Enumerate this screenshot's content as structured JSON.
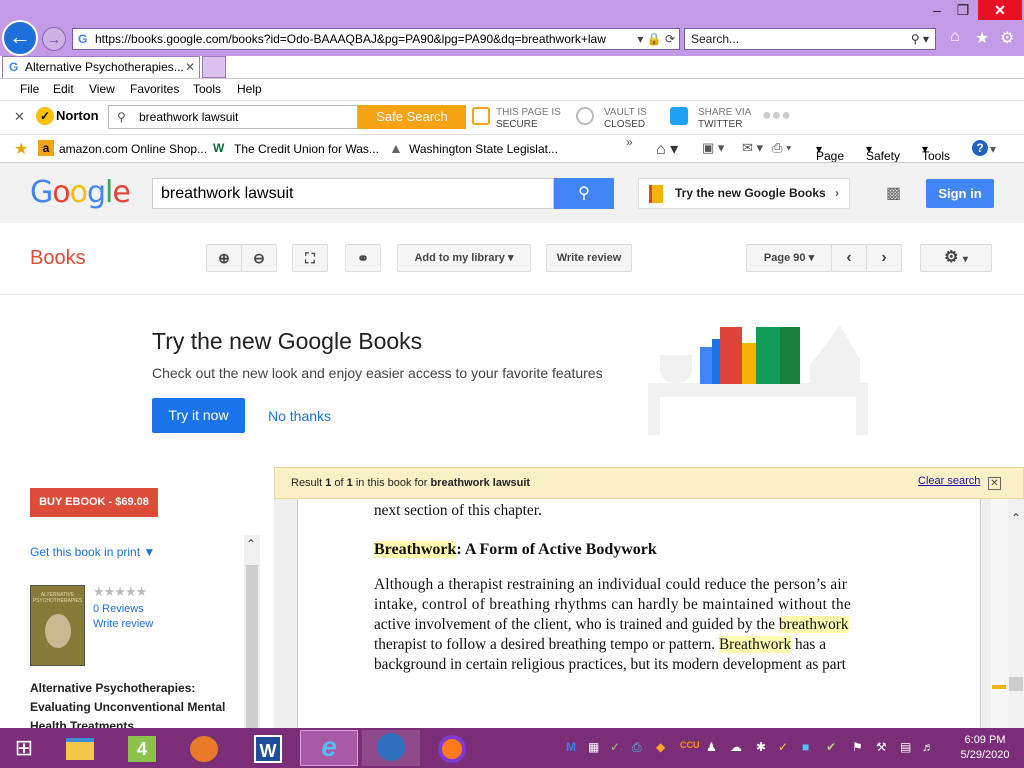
{
  "browser": {
    "url": "https://books.google.com/books?id=Odo-BAAAQBAJ&pg=PA90&lpg=PA90&dq=breathwork+law",
    "search_placeholder": "Search...",
    "tab_title": "Alternative Psychotherapies..."
  },
  "menu": [
    "File",
    "Edit",
    "View",
    "Favorites",
    "Tools",
    "Help"
  ],
  "norton": {
    "brand": "Norton",
    "query": "breathwork lawsuit",
    "safe_search": "Safe Search",
    "page_secure_1": "THIS PAGE IS",
    "page_secure_2": "SECURE",
    "vault_1": "VAULT IS",
    "vault_2": "CLOSED",
    "share_1": "SHARE VIA",
    "share_2": "TWITTER"
  },
  "favorites": {
    "items": [
      "amazon.com Online Shop...",
      "The Credit Union for Was...",
      "Washington State Legislat..."
    ],
    "cmd": {
      "page": "Page",
      "safety": "Safety",
      "tools": "Tools"
    }
  },
  "google": {
    "logo": "Google",
    "query": "breathwork lawsuit",
    "try_new": "Try the new Google Books",
    "sign_in": "Sign in"
  },
  "books_toolbar": {
    "label": "Books",
    "add_library": "Add to my library",
    "write_review": "Write review",
    "page": "Page 90"
  },
  "promo": {
    "title": "Try the new Google Books",
    "subtitle": "Check out the new look and enjoy easier access to your favorite features",
    "try_button": "Try it now",
    "no_thanks": "No thanks"
  },
  "left_panel": {
    "buy": "BUY EBOOK - $69.08",
    "get_book": "Get this book in print",
    "reviews": "0 Reviews",
    "write_review": "Write review",
    "cover_title": "ALTERNATIVE PSYCHOTHERAPIES",
    "rating": 0,
    "book_title": "Alternative Psychotherapies: Evaluating Unconventional Mental Health Treatments"
  },
  "result": {
    "prefix": "Result ",
    "n": "1",
    "of": " of ",
    "total": "1",
    "mid": " in this book for ",
    "query": "breathwork lawsuit",
    "clear": "Clear search"
  },
  "page_text": {
    "line0": "next section of this chapter.",
    "heading_hl": "Breathwork",
    "heading_rest": ": A Form of Active Bodywork",
    "l1": "Although a therapist restraining an individual could reduce the person’s air",
    "l2": "intake, control of breathing rhythms can hardly be maintained without the",
    "l3a": "active involvement of the client, who is trained and guided by the ",
    "l3hl": "breathwork",
    "l4a": "therapist to follow a desired breathing tempo or pattern. ",
    "l4hl": "Breathwork",
    "l4b": " has a",
    "l5": "background in certain religious practices, but its modern development as part"
  },
  "taskbar": {
    "time": "6:09 PM",
    "date": "5/29/2020"
  },
  "colors": {
    "titlebar": "#c39ae5",
    "taskbar": "#7b2e78",
    "google_blue": "#4285f4",
    "books_red": "#dd4b39",
    "highlight": "#fdfbb0"
  }
}
